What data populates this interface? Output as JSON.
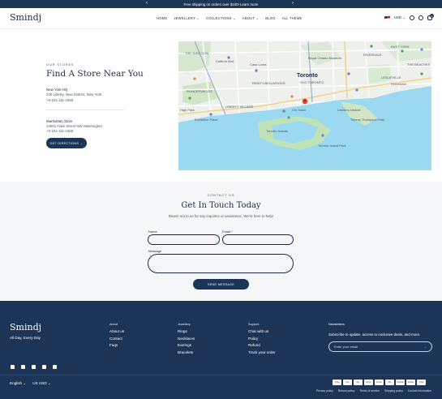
{
  "announcement": {
    "text": "Free shipping on orders over $100! Learn more"
  },
  "header": {
    "logo": "Smindj",
    "nav": [
      "HOME",
      "JEWELLERY ⌄",
      "COLLECTIONS ⌄",
      "ABOUT ⌄",
      "BLOG",
      "ALL THEME"
    ],
    "currency": "USD ⌄",
    "cart_count": "0"
  },
  "stores": {
    "eyebrow": "OUR STORES",
    "title": "Find A Store Near You",
    "list": [
      {
        "name": "New York HQ",
        "address": "230 Liberty, New District, New York",
        "phone": "+0-151-111-1555"
      },
      {
        "name": "Manhattan Store",
        "address": "14001 Fake Street NW Washington",
        "phone": "+0-151-111-1555"
      }
    ],
    "button": "GET DIRECTIONS →"
  },
  "map": {
    "labels": {
      "toronto": "Toronto",
      "old_toronto": "OLD TORONTO",
      "junction": "THE JUNCTION",
      "dufferin": "Dufferin Mall",
      "casa_loma": "Casa Loma",
      "roncesvalles": "RONCESVALLES",
      "trinity": "TRINITY-BELLWOODS",
      "liberty": "LIBERTY VILLAGE",
      "royal_ontario": "Royal Ontario Museum",
      "leslieville": "LESLIEVILLE",
      "riverdale": "RIVERDALE",
      "east_york": "EAST YORK",
      "the_beaches": "THE BEACHES",
      "cn_tower": "CN Tower",
      "toronto_islands": "Toronto Islands",
      "island_park": "Toronto Island Park",
      "high_park": "High Park",
      "greek_town": "Greektown",
      "distillery": "Distillery District",
      "tommy": "Tommy Thompson Park",
      "exhibition": "Exhibition Place"
    }
  },
  "contact": {
    "eyebrow": "CONTACT US",
    "title": "Get In Touch Today",
    "subtitle": "Reach out to us for any inquiries or assistance. We're here to help!",
    "name_label": "Name",
    "email_label": "Email *",
    "message_label": "Message",
    "button": "SEND MESSAGE"
  },
  "footer": {
    "logo": "Smindj",
    "tagline": "All Day, Every Day",
    "columns": [
      {
        "heading": "About",
        "links": [
          "About us",
          "Contact",
          "Faqs"
        ]
      },
      {
        "heading": "Jewellery",
        "links": [
          "Rings",
          "Necklaces",
          "Earrings",
          "Bracelets"
        ]
      },
      {
        "heading": "Support",
        "links": [
          "Chat with us",
          "Policy",
          "Refund",
          "Track your order"
        ]
      }
    ],
    "newsletter": {
      "heading": "Newsletters",
      "description": "Subscribe to update, access to exclusive deals, and more.",
      "placeholder": "Enter your email"
    },
    "language": "English ⌄",
    "currency": "US USD ⌄",
    "payments": [
      "VISA",
      "Pay",
      "DC",
      "DISC",
      "G Pay",
      "MC",
      "PayPal",
      "ShPay",
      "VISA"
    ],
    "legal": [
      "Privacy policy",
      "Refund policy",
      "Terms of service",
      "Shipping policy",
      "Contact information"
    ]
  }
}
